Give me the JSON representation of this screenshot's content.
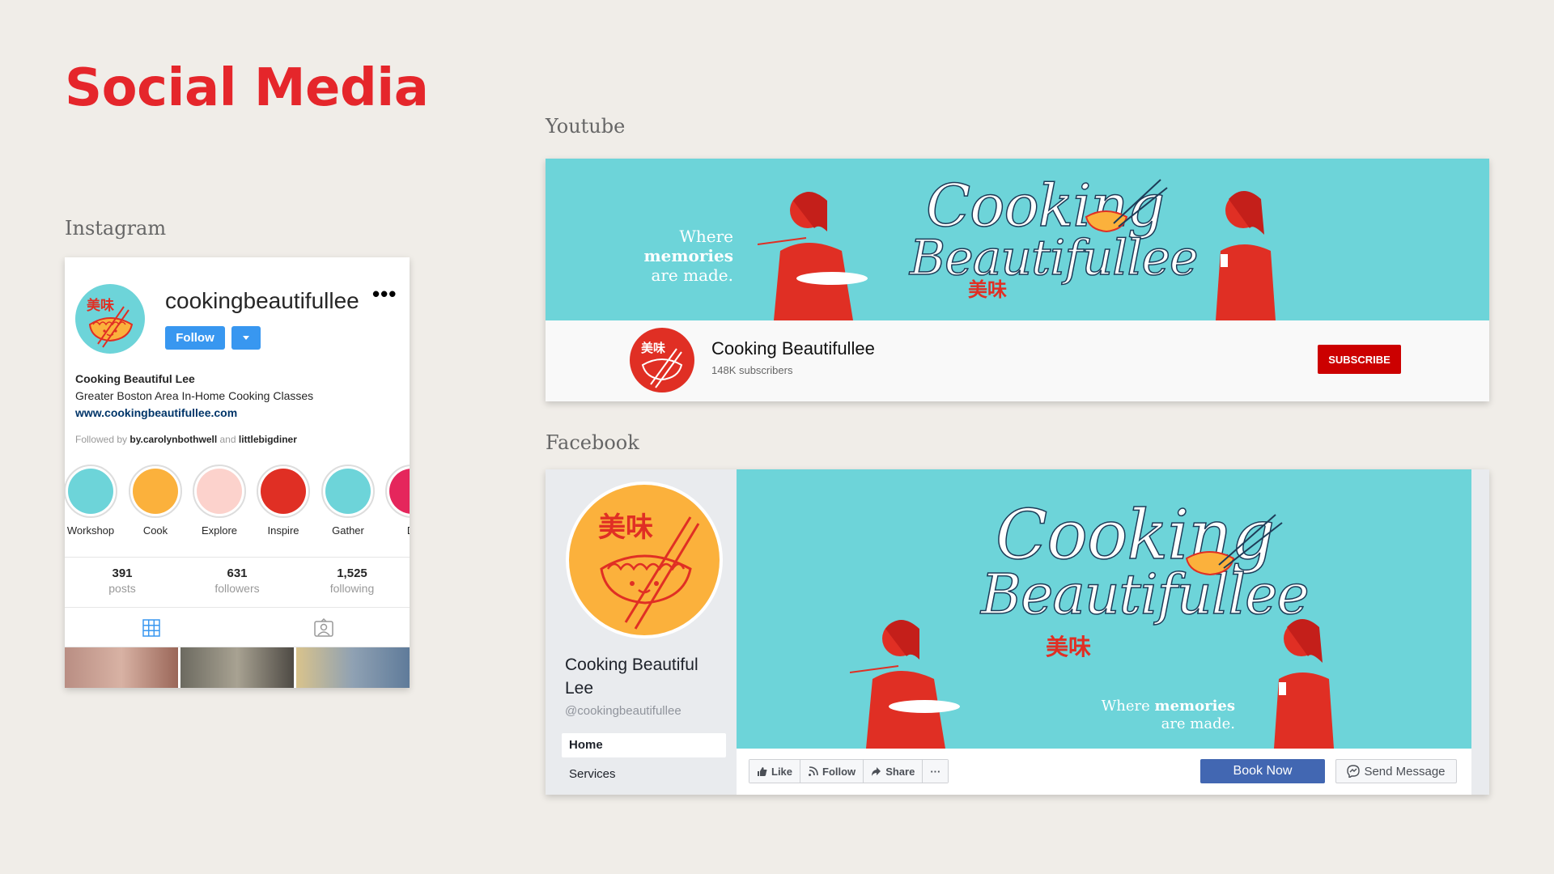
{
  "page": {
    "title": "Social Media"
  },
  "labels": {
    "instagram": "Instagram",
    "youtube": "Youtube",
    "facebook": "Facebook"
  },
  "brand": {
    "script_top": "Cooking",
    "script_bottom": "Beautifullee",
    "chinese": "美味",
    "tagline_pre": "Where ",
    "tagline_bold": "memories",
    "tagline_post": "are made."
  },
  "colors": {
    "accent_red": "#e5262b",
    "teal": "#6dd4d9",
    "yellow": "#fbb13c",
    "ig_blue": "#3897f0",
    "yt_red": "#cc0000",
    "fb_blue": "#4267b2"
  },
  "instagram": {
    "username": "cookingbeautifullee",
    "more_icon": "•••",
    "follow_label": "Follow",
    "display_name": "Cooking Beautiful Lee",
    "bio": "Greater Boston Area In-Home Cooking Classes",
    "website": "www.cookingbeautifullee.com",
    "followed_by_prefix": "Followed by ",
    "followed_user_1": "by.carolynbothwell",
    "followed_and": " and ",
    "followed_user_2": "littlebigdiner",
    "highlights": [
      {
        "label": "Workshop",
        "color": "#6dd4d9",
        "icon": "whisk-bowl-icon"
      },
      {
        "label": "Cook",
        "color": "#fbb13c",
        "icon": "pan-icon"
      },
      {
        "label": "Explore",
        "color": "#fcd2cc",
        "icon": "airplane-icon"
      },
      {
        "label": "Inspire",
        "color": "#e02f24",
        "icon": "yoga-icon"
      },
      {
        "label": "Gather",
        "color": "#6dd4d9",
        "icon": "flame-icon"
      },
      {
        "label": "Di",
        "color": "#e5265c",
        "icon": "dish-icon"
      }
    ],
    "stats": [
      {
        "value": "391",
        "label": "posts"
      },
      {
        "value": "631",
        "label": "followers"
      },
      {
        "value": "1,525",
        "label": "following"
      }
    ]
  },
  "youtube": {
    "channel_name": "Cooking Beautifullee",
    "subscribers": "148K subscribers",
    "subscribe_label": "SUBSCRIBE"
  },
  "facebook": {
    "page_name": "Cooking Beautiful Lee",
    "handle": "@cookingbeautifullee",
    "nav": [
      "Home",
      "Services"
    ],
    "actions": [
      "Like",
      "Follow",
      "Share",
      "···"
    ],
    "book_label": "Book Now",
    "message_label": "Send Message"
  }
}
